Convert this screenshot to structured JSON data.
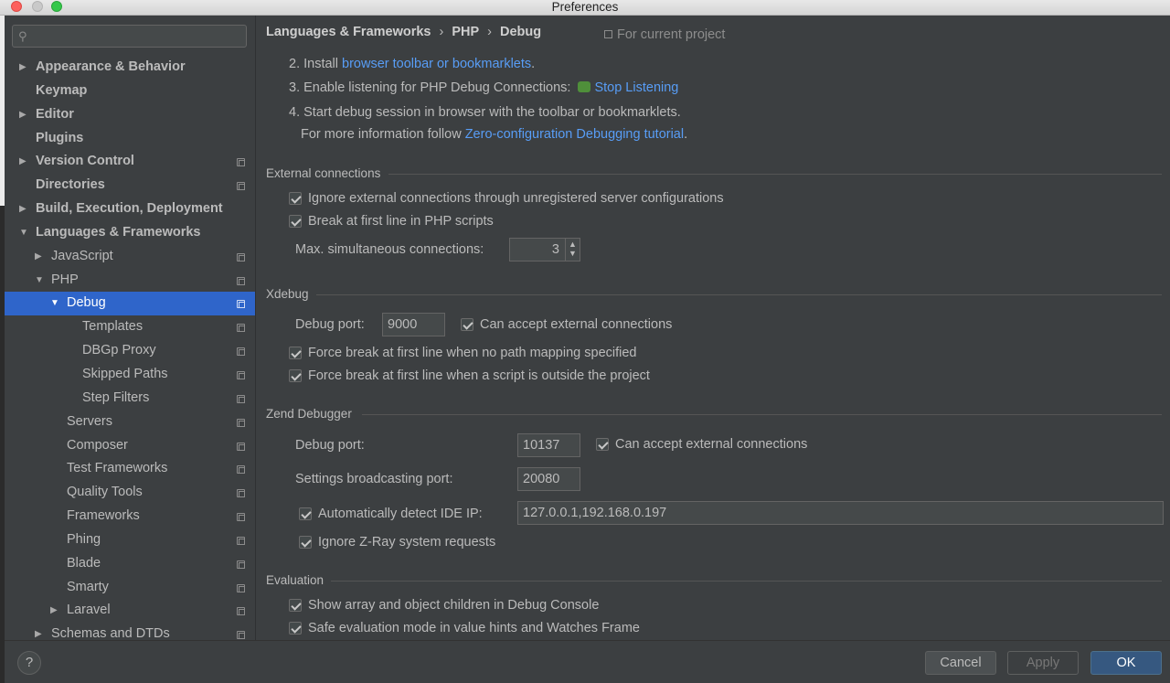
{
  "window": {
    "title": "Preferences"
  },
  "search": {
    "placeholder": ""
  },
  "sidebar": {
    "items": [
      {
        "label": "Appearance & Behavior",
        "arrow": "▶",
        "bold": true,
        "proj": false
      },
      {
        "label": "Keymap",
        "arrow": "",
        "bold": true,
        "proj": false
      },
      {
        "label": "Editor",
        "arrow": "▶",
        "bold": true,
        "proj": false
      },
      {
        "label": "Plugins",
        "arrow": "",
        "bold": true,
        "proj": false
      },
      {
        "label": "Version Control",
        "arrow": "▶",
        "bold": true,
        "proj": true
      },
      {
        "label": "Directories",
        "arrow": "",
        "bold": true,
        "proj": true
      },
      {
        "label": "Build, Execution, Deployment",
        "arrow": "▶",
        "bold": true,
        "proj": false
      },
      {
        "label": "Languages & Frameworks",
        "arrow": "▼",
        "bold": true,
        "proj": false
      },
      {
        "label": "JavaScript",
        "arrow": "▶",
        "bold": false,
        "proj": true
      },
      {
        "label": "PHP",
        "arrow": "▼",
        "bold": false,
        "proj": true
      },
      {
        "label": "Debug",
        "arrow": "▼",
        "bold": false,
        "proj": true,
        "selected": true
      },
      {
        "label": "Templates",
        "arrow": "",
        "bold": false,
        "proj": true
      },
      {
        "label": "DBGp Proxy",
        "arrow": "",
        "bold": false,
        "proj": true
      },
      {
        "label": "Skipped Paths",
        "arrow": "",
        "bold": false,
        "proj": true
      },
      {
        "label": "Step Filters",
        "arrow": "",
        "bold": false,
        "proj": true
      },
      {
        "label": "Servers",
        "arrow": "",
        "bold": false,
        "proj": true
      },
      {
        "label": "Composer",
        "arrow": "",
        "bold": false,
        "proj": true
      },
      {
        "label": "Test Frameworks",
        "arrow": "",
        "bold": false,
        "proj": true
      },
      {
        "label": "Quality Tools",
        "arrow": "",
        "bold": false,
        "proj": true
      },
      {
        "label": "Frameworks",
        "arrow": "",
        "bold": false,
        "proj": true
      },
      {
        "label": "Phing",
        "arrow": "",
        "bold": false,
        "proj": true
      },
      {
        "label": "Blade",
        "arrow": "",
        "bold": false,
        "proj": true
      },
      {
        "label": "Smarty",
        "arrow": "",
        "bold": false,
        "proj": true
      },
      {
        "label": "Laravel",
        "arrow": "▶",
        "bold": false,
        "proj": true
      },
      {
        "label": "Schemas and DTDs",
        "arrow": "▶",
        "bold": false,
        "proj": true
      }
    ]
  },
  "breadcrumb": {
    "part1": "Languages & Frameworks",
    "sep": "›",
    "part2": "PHP",
    "part3": "Debug"
  },
  "for_project": "For current project",
  "instructions": {
    "step2_prefix": "2. Install ",
    "step2_link": "browser toolbar or bookmarklets",
    "step2_suffix": ".",
    "step3_prefix": "3. Enable listening for PHP Debug Connections:",
    "step3_link": "Stop Listening",
    "step4": "4. Start debug session in browser with the toolbar or bookmarklets.",
    "more_prefix": "For more information follow ",
    "more_link": "Zero-configuration Debugging tutorial",
    "more_suffix": "."
  },
  "external": {
    "title": "External connections",
    "ignore_label": "Ignore external connections through unregistered server configurations",
    "break_label": "Break at first line in PHP scripts",
    "max_label": "Max. simultaneous connections:",
    "max_value": "3"
  },
  "xdebug": {
    "title": "Xdebug",
    "port_label": "Debug port:",
    "port_value": "9000",
    "accept_label": "Can accept external connections",
    "force_mapping_label": "Force break at first line when no path mapping specified",
    "force_outside_label": "Force break at first line when a script is outside the project"
  },
  "zend": {
    "title": "Zend Debugger",
    "port_label": "Debug port:",
    "port_value": "10137",
    "accept_label": "Can accept external connections",
    "broadcast_label": "Settings broadcasting port:",
    "broadcast_value": "20080",
    "auto_ip_label": "Automatically detect IDE IP:",
    "ip_value": "127.0.0.1,192.168.0.197",
    "zray_label": "Ignore Z-Ray system requests"
  },
  "evaluation": {
    "title": "Evaluation",
    "show_children_label": "Show array and object children in Debug Console",
    "safe_mode_label": "Safe evaluation mode in value hints and Watches Frame"
  },
  "buttons": {
    "help": "?",
    "cancel": "Cancel",
    "apply": "Apply",
    "ok": "OK"
  }
}
